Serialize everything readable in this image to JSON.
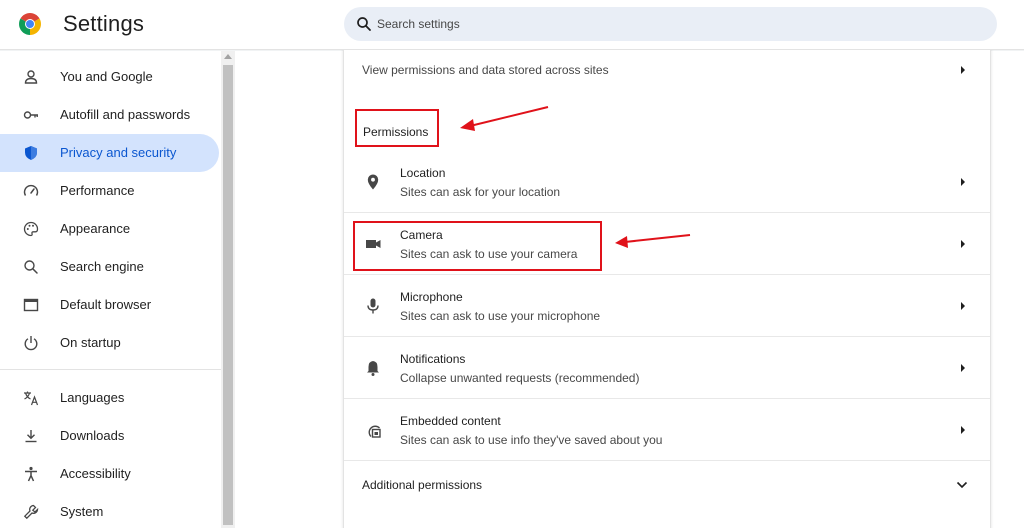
{
  "header": {
    "title": "Settings",
    "search_placeholder": "Search settings",
    "search_value": ""
  },
  "sidebar": {
    "items": [
      {
        "label": "You and Google",
        "icon": "person-icon",
        "active": false
      },
      {
        "label": "Autofill and passwords",
        "icon": "key-icon",
        "active": false
      },
      {
        "label": "Privacy and security",
        "icon": "shield-icon",
        "active": true
      },
      {
        "label": "Performance",
        "icon": "speedometer-icon",
        "active": false
      },
      {
        "label": "Appearance",
        "icon": "palette-icon",
        "active": false
      },
      {
        "label": "Search engine",
        "icon": "search-icon",
        "active": false
      },
      {
        "label": "Default browser",
        "icon": "browser-window-icon",
        "active": false
      },
      {
        "label": "On startup",
        "icon": "power-icon",
        "active": false
      },
      {
        "label": "Languages",
        "icon": "translate-icon",
        "active": false
      },
      {
        "label": "Downloads",
        "icon": "download-icon",
        "active": false
      },
      {
        "label": "Accessibility",
        "icon": "accessibility-icon",
        "active": false
      },
      {
        "label": "System",
        "icon": "wrench-icon",
        "active": false
      }
    ]
  },
  "main": {
    "view_permissions": "View permissions and data stored across sites",
    "section_title": "Permissions",
    "permissions": [
      {
        "title": "Location",
        "subtitle": "Sites can ask for your location",
        "icon": "location-pin-icon"
      },
      {
        "title": "Camera",
        "subtitle": "Sites can ask to use your camera",
        "icon": "camera-icon"
      },
      {
        "title": "Microphone",
        "subtitle": "Sites can ask to use your microphone",
        "icon": "microphone-icon"
      },
      {
        "title": "Notifications",
        "subtitle": "Collapse unwanted requests (recommended)",
        "icon": "bell-icon"
      },
      {
        "title": "Embedded content",
        "subtitle": "Sites can ask to use info they've saved about you",
        "icon": "embedded-content-icon"
      }
    ],
    "additional_permissions": "Additional permissions"
  },
  "colors": {
    "accent": "#0b57d0",
    "active_background": "#d3e3fd",
    "search_background": "#e9eef6",
    "annotation": "#e0121a"
  }
}
